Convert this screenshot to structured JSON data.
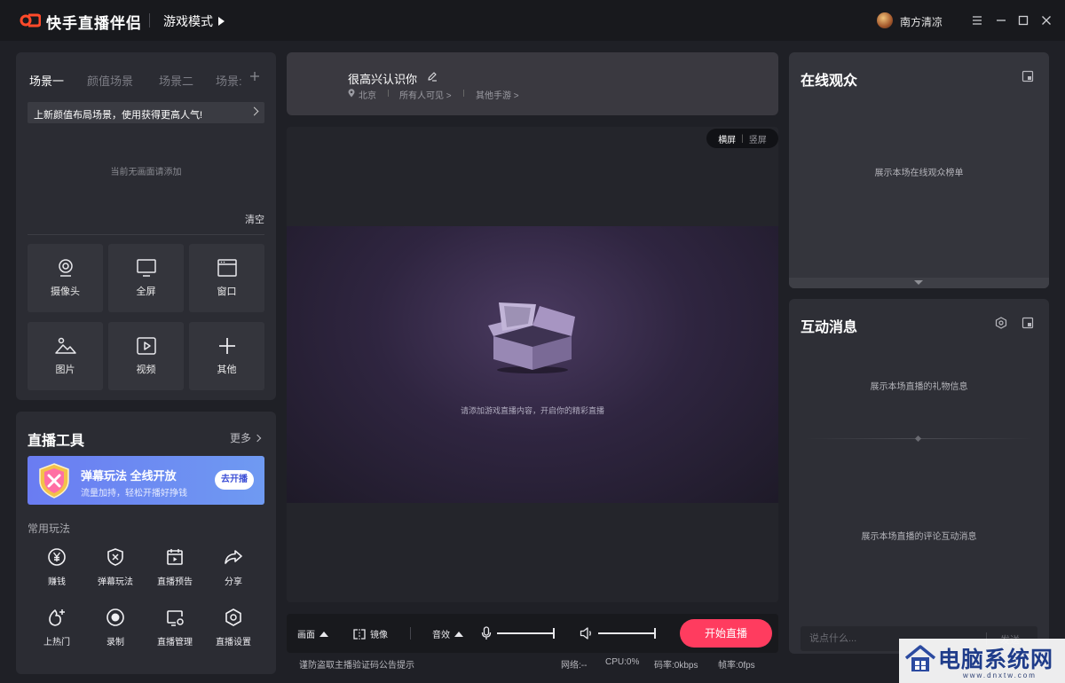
{
  "app": {
    "title": "快手直播伴侣",
    "mode": "游戏模式",
    "username": "南方清凉"
  },
  "scene": {
    "tabs": [
      "场景一",
      "颜值场景",
      "场景二",
      "场景:"
    ],
    "banner": "上新颜值布局场景，使用获得更高人气!",
    "empty_note": "当前无画面请添加",
    "clear_label": "清空",
    "sources": [
      {
        "label": "摄像头",
        "icon": "camera-icon"
      },
      {
        "label": "全屏",
        "icon": "monitor-icon"
      },
      {
        "label": "窗口",
        "icon": "window-icon"
      },
      {
        "label": "图片",
        "icon": "image-icon"
      },
      {
        "label": "视频",
        "icon": "video-icon"
      },
      {
        "label": "其他",
        "icon": "plus-icon"
      }
    ]
  },
  "tools": {
    "title": "直播工具",
    "more_label": "更多",
    "promo": {
      "title": "弹幕玩法 全线开放",
      "subtitle": "流量加持，轻松开播好挣钱",
      "button": "去开播",
      "colors": [
        "#6a7cf2",
        "#6f9af2"
      ]
    },
    "common_label": "常用玩法",
    "items": [
      {
        "label": "赚钱",
        "icon": "yen-icon"
      },
      {
        "label": "弹幕玩法",
        "icon": "shield-x-icon"
      },
      {
        "label": "直播预告",
        "icon": "calendar-play-icon"
      },
      {
        "label": "分享",
        "icon": "share-icon"
      },
      {
        "label": "上热门",
        "icon": "fire-plus-icon"
      },
      {
        "label": "录制",
        "icon": "record-icon"
      },
      {
        "label": "直播管理",
        "icon": "screen-gear-icon"
      },
      {
        "label": "直播设置",
        "icon": "hexagon-gear-icon"
      }
    ]
  },
  "info": {
    "stream_title": "很高兴认识你",
    "location": "北京",
    "visibility": "所有人可见 >",
    "category": "其他手游 >"
  },
  "preview": {
    "landscape": "横屏",
    "portrait": "竖屏",
    "hint": "请添加游戏直播内容，开启你的精彩直播"
  },
  "controls": {
    "picture": "画面",
    "mirror": "镜像",
    "sound_effect": "音效",
    "start_button": "开始直播",
    "accent": "#ff3c5f"
  },
  "status": {
    "notice": "谨防盗取主播验证码公告提示",
    "network": "网络:--",
    "cpu": "CPU:0%",
    "bitrate": "码率:0kbps",
    "framerate": "帧率:0fps"
  },
  "viewers": {
    "title": "在线观众",
    "note": "展示本场在线观众榜单"
  },
  "messages": {
    "title": "互动消息",
    "gift_note": "展示本场直播的礼物信息",
    "comment_note": "展示本场直播的评论互动消息",
    "input_placeholder": "说点什么...",
    "send_label": "发送"
  },
  "watermark": {
    "text": "电脑系统网",
    "url": "www.dnxtw.com"
  }
}
